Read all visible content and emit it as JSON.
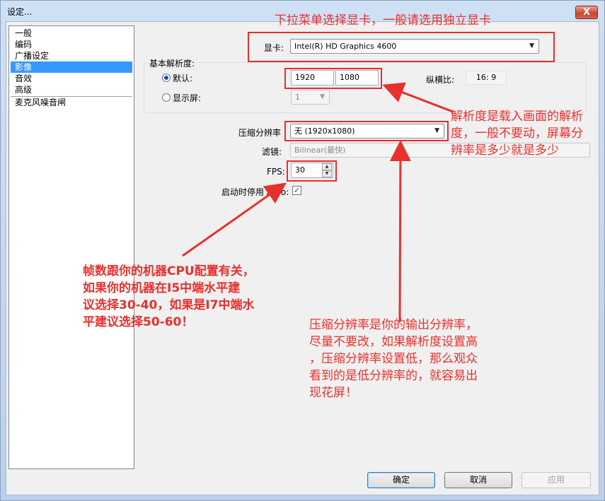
{
  "window": {
    "title": "设定...",
    "close_label": "X"
  },
  "nav": {
    "items": [
      {
        "label": "一般"
      },
      {
        "label": "编码"
      },
      {
        "label": "广播设定"
      },
      {
        "label": "影像"
      },
      {
        "label": "音效"
      },
      {
        "label": "高级"
      },
      {
        "label": "麦克风噪音闸"
      }
    ]
  },
  "video": {
    "gpu_label": "显卡:",
    "gpu_value": "Intel(R) HD Graphics 4600",
    "base_res_group": "基本解析度:",
    "default_label": "默认:",
    "width": "1920",
    "height": "1080",
    "aspect_label": "纵横比:",
    "aspect_value": "16: 9",
    "monitor_label": "显示屏:",
    "monitor_value": "1",
    "downscale_label": "压缩分辨率",
    "downscale_value": "无  (1920x1080)",
    "filter_label": "滤镜:",
    "filter_value": "Bilinear(最快)",
    "fps_label": "FPS:",
    "fps_value": "30",
    "aero_label": "启动时停用 Aero:",
    "aero_checked": "✓"
  },
  "buttons": {
    "ok": "确定",
    "cancel": "取消",
    "apply": "应用"
  },
  "annotations": {
    "gpu_note": "下拉菜单选择显卡，一般请选用独立显卡",
    "res_note": [
      "解析度是载入画面的解析",
      "度，一般不要动，屏幕分",
      "辨率是多少就是多少"
    ],
    "fps_note": [
      "帧数跟你的机器CPU配置有关，",
      "如果你的机器在I5中端水平建",
      "议选择30-40，如果是I7中端水",
      "平建议选择50-60！"
    ],
    "downscale_note": [
      "压缩分辨率是你的输出分辨率，",
      "尽量不要改，如果解析度设置高",
      "，压缩分辨率设置低，那么观众",
      "看到的是低分辨率的，就容易出",
      "现花屏！"
    ],
    "color": "#e8302c"
  }
}
